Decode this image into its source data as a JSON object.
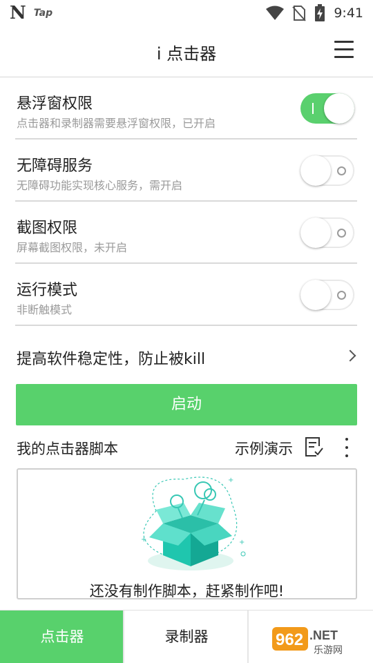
{
  "status_bar": {
    "logo_text": "N",
    "app_badge": "Tap",
    "time": "9:41",
    "icons": [
      "wifi-icon",
      "no-sim-icon",
      "battery-charging-icon"
    ]
  },
  "header": {
    "title": "i 点击器",
    "menu_icon": "hamburger-menu-icon"
  },
  "permissions": [
    {
      "title": "悬浮窗权限",
      "desc": "点击器和录制器需要悬浮窗权限，已开启",
      "enabled": true
    },
    {
      "title": "无障碍服务",
      "desc": "无障碍功能实现核心服务，需开启",
      "enabled": false
    },
    {
      "title": "截图权限",
      "desc": "屏幕截图权限，未开启",
      "enabled": false
    },
    {
      "title": "运行模式",
      "desc": "非断触模式",
      "enabled": false
    }
  ],
  "stability": {
    "label": "提高软件稳定性，防止被kill",
    "icon": "chevron-right-icon"
  },
  "start_button": {
    "label": "启动"
  },
  "scripts": {
    "title": "我的点击器脚本",
    "demo_label": "示例演示",
    "demo_icon": "document-edit-icon",
    "more_icon": "more-vertical-icon",
    "empty_text": "还没有制作脚本，赶紧制作吧!",
    "illustration": "open-box-illustration"
  },
  "bottom_nav": {
    "tabs": [
      {
        "label": "点击器",
        "active": true
      },
      {
        "label": "录制器",
        "active": false
      }
    ]
  },
  "watermark": {
    "brand": "962.NET",
    "sub": "乐游网"
  },
  "colors": {
    "accent": "#58d16c",
    "divider": "#d9d9d9",
    "text_secondary": "#9a9a9a"
  }
}
